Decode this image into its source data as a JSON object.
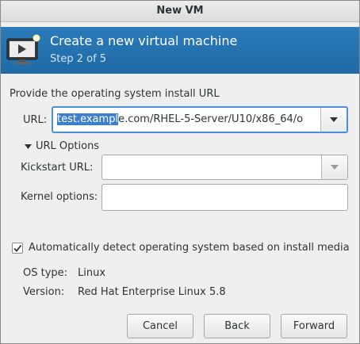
{
  "window": {
    "title": "New VM"
  },
  "banner": {
    "title": "Create a new virtual machine",
    "step": "Step 2 of 5",
    "icon": "monitor-play-icon"
  },
  "install": {
    "heading": "Provide the operating system install URL",
    "url_label": "URL:",
    "url_selected_part": "test.examp",
    "url_cursor_part": "l",
    "url_rest": "e.com/RHEL-5-Server/U10/x86_64/o",
    "options_toggle": "URL Options",
    "kickstart_label": "Kickstart URL:",
    "kickstart_value": "",
    "kernel_label": "Kernel options:",
    "kernel_value": ""
  },
  "detect": {
    "checkbox_label": "Automatically detect operating system based on install media",
    "checked": true,
    "os_type_label": "OS type:",
    "os_type_value": "Linux",
    "version_label": "Version:",
    "version_value": "Red Hat Enterprise Linux 5.8"
  },
  "buttons": {
    "cancel": "Cancel",
    "back": "Back",
    "forward": "Forward"
  },
  "colors": {
    "banner": "#2a76b3",
    "selection": "#3d7fcc",
    "focus": "#4a90d9"
  }
}
